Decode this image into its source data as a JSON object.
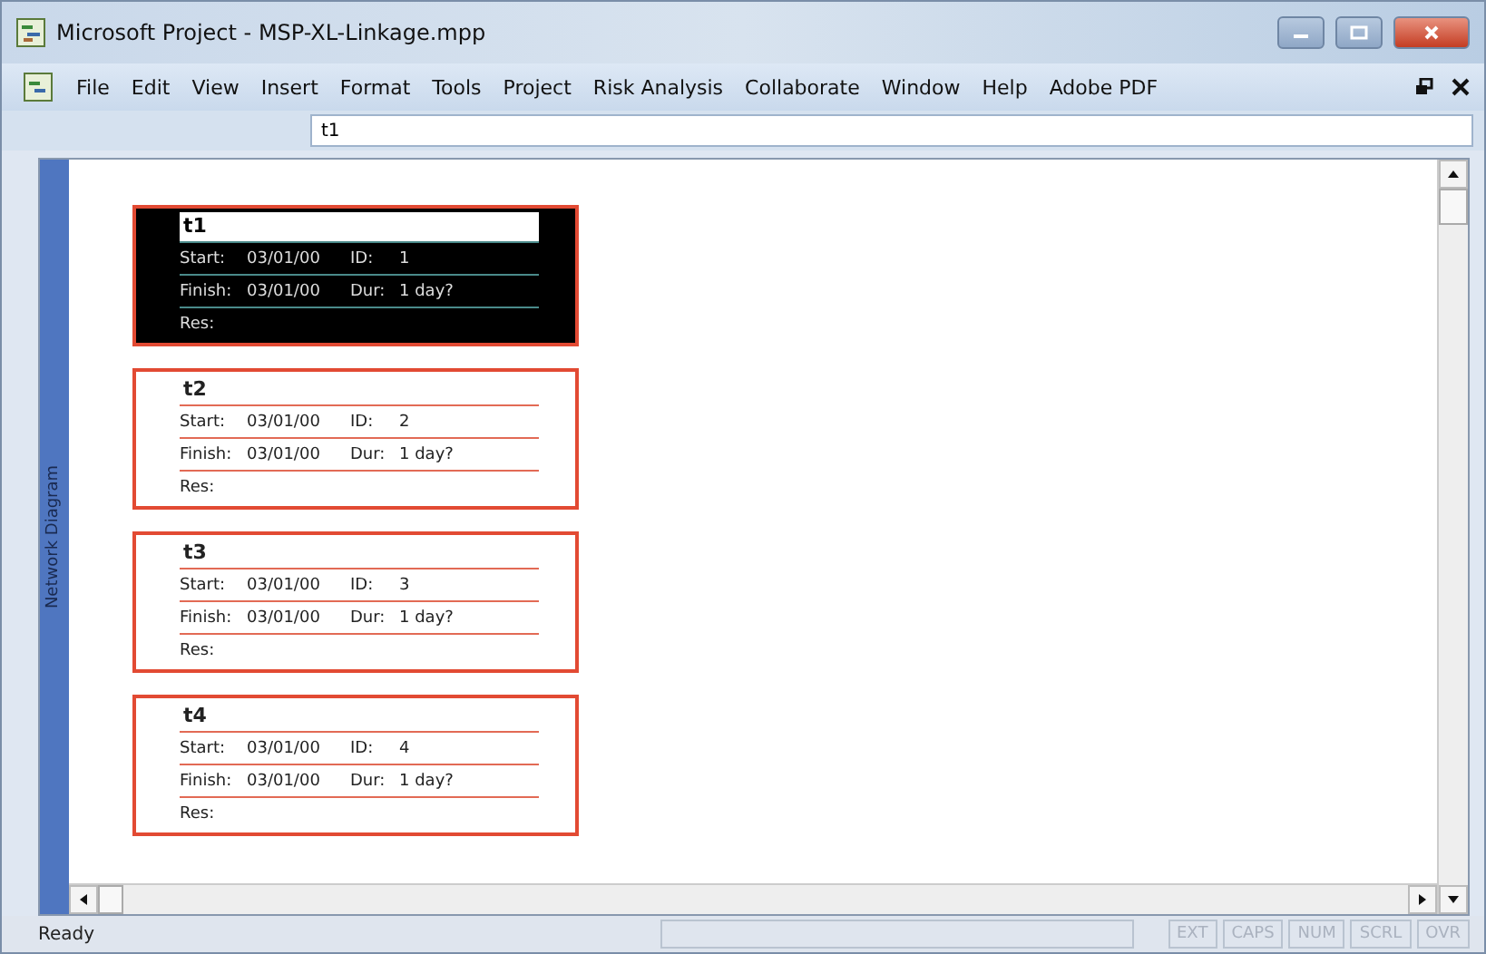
{
  "window": {
    "title": "Microsoft Project - MSP-XL-Linkage.mpp"
  },
  "menu": [
    "File",
    "Edit",
    "View",
    "Insert",
    "Format",
    "Tools",
    "Project",
    "Risk Analysis",
    "Collaborate",
    "Window",
    "Help",
    "Adobe PDF"
  ],
  "entry_bar": {
    "value": "t1"
  },
  "side_tab": {
    "label": "Network Diagram"
  },
  "tasks": [
    {
      "name": "t1",
      "selected": true,
      "start_label": "Start:",
      "start": "03/01/00",
      "id_label": "ID:",
      "id": "1",
      "finish_label": "Finish:",
      "finish": "03/01/00",
      "dur_label": "Dur:",
      "dur": "1 day?",
      "res_label": "Res:"
    },
    {
      "name": "t2",
      "selected": false,
      "start_label": "Start:",
      "start": "03/01/00",
      "id_label": "ID:",
      "id": "2",
      "finish_label": "Finish:",
      "finish": "03/01/00",
      "dur_label": "Dur:",
      "dur": "1 day?",
      "res_label": "Res:"
    },
    {
      "name": "t3",
      "selected": false,
      "start_label": "Start:",
      "start": "03/01/00",
      "id_label": "ID:",
      "id": "3",
      "finish_label": "Finish:",
      "finish": "03/01/00",
      "dur_label": "Dur:",
      "dur": "1 day?",
      "res_label": "Res:"
    },
    {
      "name": "t4",
      "selected": false,
      "start_label": "Start:",
      "start": "03/01/00",
      "id_label": "ID:",
      "id": "4",
      "finish_label": "Finish:",
      "finish": "03/01/00",
      "dur_label": "Dur:",
      "dur": "1 day?",
      "res_label": "Res:"
    }
  ],
  "status_bar": {
    "text": "Ready",
    "indicators": [
      {
        "label": "EXT",
        "disabled": true
      },
      {
        "label": "CAPS",
        "disabled": true
      },
      {
        "label": "NUM",
        "disabled": true
      },
      {
        "label": "SCRL",
        "disabled": true
      },
      {
        "label": "OVR",
        "disabled": true
      }
    ]
  }
}
